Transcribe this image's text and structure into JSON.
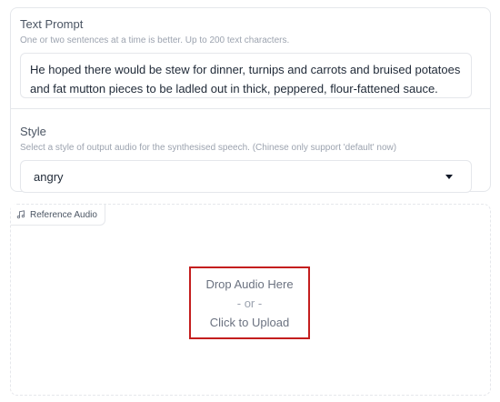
{
  "text_prompt": {
    "label": "Text Prompt",
    "info": "One or two sentences at a time is better. Up to 200 text characters.",
    "value": "He hoped there would be stew for dinner, turnips and carrots and bruised potatoes and fat mutton pieces to be ladled out in thick, peppered, flour-fattened sauce."
  },
  "style": {
    "label": "Style",
    "info": "Select a style of output audio for the synthesised speech. (Chinese only support 'default' now)",
    "selected": "angry"
  },
  "reference_audio": {
    "label": "Reference Audio",
    "icon": "music-note-icon",
    "drop_text": "Drop Audio Here",
    "or_text": "- or -",
    "upload_text": "Click to Upload",
    "highlight_color": "#c41e1e"
  }
}
